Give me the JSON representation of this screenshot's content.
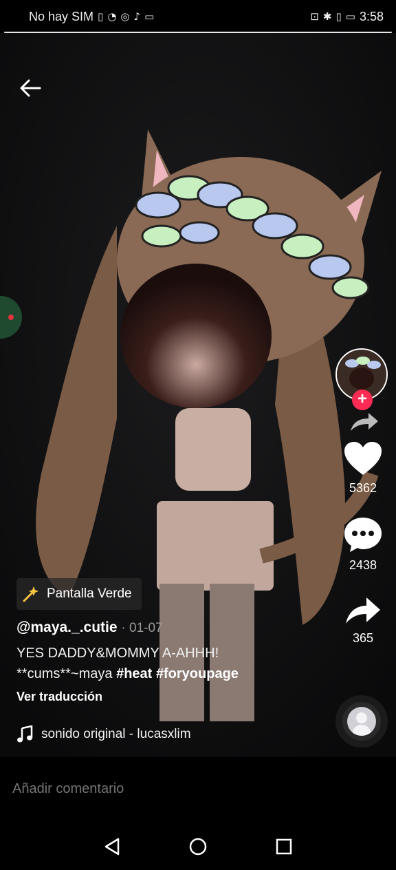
{
  "status": {
    "carrier": "No hay SIM",
    "time": "3:58"
  },
  "video": {
    "effect_label": "Pantalla Verde",
    "username": "@maya._.cutie",
    "date": "01-07",
    "caption_line1": "YES DADDY&MOMMY A-AHHH!",
    "caption_line2_text": "**cums**~maya",
    "hashtag1": "#heat",
    "hashtag2": "#foryoupage",
    "translate_label": "Ver traducción",
    "music": "sonido original - lucasxlim"
  },
  "actions": {
    "likes": "5362",
    "comments": "2438",
    "shares": "365"
  },
  "comment": {
    "placeholder": "Añadir comentario"
  },
  "colors": {
    "accent": "#fe2c55",
    "background": "#0f0f10"
  }
}
